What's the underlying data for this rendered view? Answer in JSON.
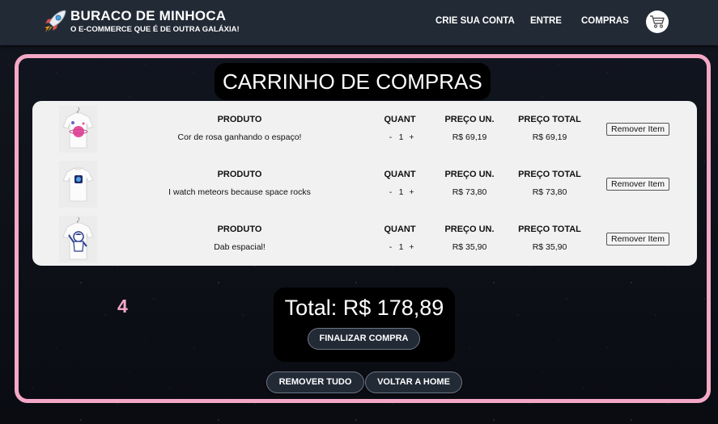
{
  "header": {
    "brand_title": "BURACO DE MINHOCA",
    "brand_subtitle": "O E-COMMERCE QUE É DE OUTRA GALÁXIA!",
    "logo_icon": "rocket-icon",
    "nav": [
      {
        "label": "CRIE SUA CONTA"
      },
      {
        "label": "ENTRE"
      },
      {
        "label": "COMPRAS"
      }
    ],
    "cart_icon": "shopping-cart-icon"
  },
  "page_title": "CARRINHO DE COMPRAS",
  "table_headers": {
    "product": "PRODUTO",
    "quantity": "QUANT",
    "unit_price": "PREÇO UN.",
    "total_price": "PREÇO TOTAL"
  },
  "items": [
    {
      "name": "Cor de rosa ganhando o espaço!",
      "qty": "1",
      "unit_price": "R$ 69,19",
      "total_price": "R$ 69,19",
      "remove_label": "Remover Item",
      "decrement": "-",
      "increment": "+",
      "image_icon": "tshirt-pink-planet-image"
    },
    {
      "name": "I watch meteors because space rocks",
      "qty": "1",
      "unit_price": "R$ 73,80",
      "total_price": "R$ 73,80",
      "remove_label": "Remover Item",
      "decrement": "-",
      "increment": "+",
      "image_icon": "tshirt-astronaut-image"
    },
    {
      "name": "Dab espacial!",
      "qty": "1",
      "unit_price": "R$ 35,90",
      "total_price": "R$ 35,90",
      "remove_label": "Remover Item",
      "decrement": "-",
      "increment": "+",
      "image_icon": "tshirt-dab-astronaut-image"
    }
  ],
  "item_count": "4",
  "total_text": "Total: R$ 178,89",
  "buttons": {
    "checkout": "FINALIZAR COMPRA",
    "clear_all": "REMOVER TUDO",
    "back_home": "VOLTAR A HOME"
  },
  "colors": {
    "header_bg": "#222a36",
    "frame_border": "#f4a8c6",
    "table_bg": "#f1f1f1",
    "accent_pink": "#f4a8c6"
  }
}
